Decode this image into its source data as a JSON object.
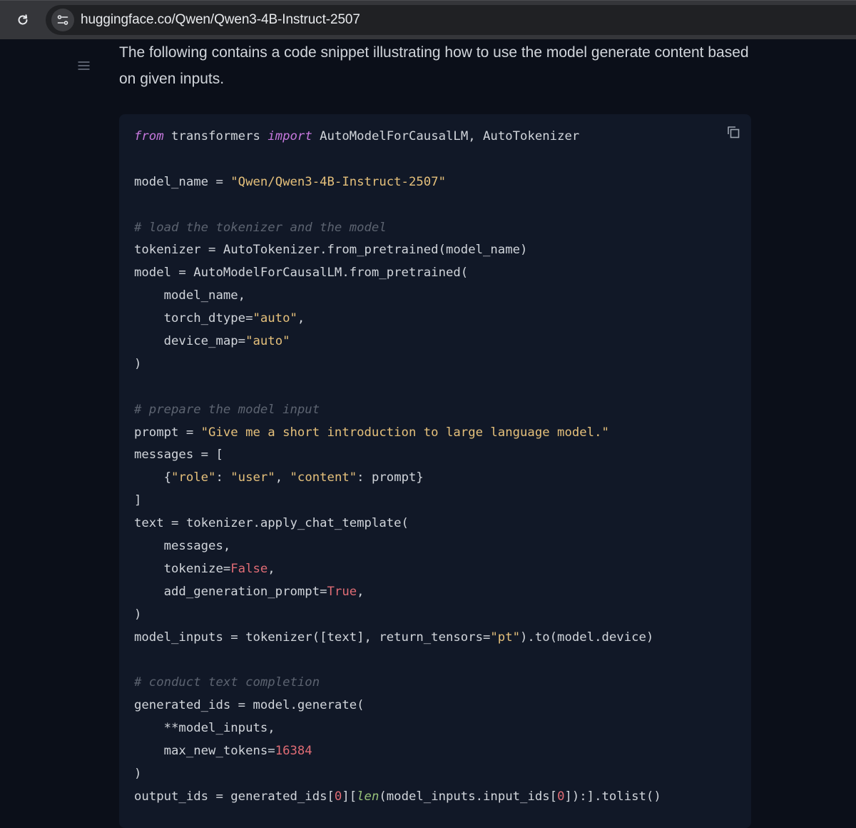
{
  "browser": {
    "url": "huggingface.co/Qwen/Qwen3-4B-Instruct-2507",
    "icons": {
      "reload": "reload-icon",
      "site_info": "site-info-icon"
    }
  },
  "page": {
    "intro_text": "The following contains a code snippet illustrating how to use the model generate content based on given inputs.",
    "icons": {
      "toc": "menu-icon",
      "copy": "copy-icon"
    }
  },
  "colors": {
    "keyword": "#c678dd",
    "string": "#e5c07b",
    "comment": "#5c6370",
    "boolean": "#e06c75",
    "number": "#e06c75",
    "builtin": "#98c379",
    "plain": "#d1d5db"
  },
  "code": {
    "language": "python",
    "lines": [
      [
        {
          "t": "from",
          "k": "keyword"
        },
        {
          "t": " transformers ",
          "k": "plain"
        },
        {
          "t": "import",
          "k": "keyword"
        },
        {
          "t": " AutoModelForCausalLM, AutoTokenizer",
          "k": "plain"
        }
      ],
      [],
      [
        {
          "t": "model_name = ",
          "k": "plain"
        },
        {
          "t": "\"Qwen/Qwen3-4B-Instruct-2507\"",
          "k": "string"
        }
      ],
      [],
      [
        {
          "t": "# load the tokenizer and the model",
          "k": "comment"
        }
      ],
      [
        {
          "t": "tokenizer = AutoTokenizer.from_pretrained(model_name)",
          "k": "plain"
        }
      ],
      [
        {
          "t": "model = AutoModelForCausalLM.from_pretrained(",
          "k": "plain"
        }
      ],
      [
        {
          "t": "    model_name,",
          "k": "plain"
        }
      ],
      [
        {
          "t": "    torch_dtype=",
          "k": "plain"
        },
        {
          "t": "\"auto\"",
          "k": "string"
        },
        {
          "t": ",",
          "k": "plain"
        }
      ],
      [
        {
          "t": "    device_map=",
          "k": "plain"
        },
        {
          "t": "\"auto\"",
          "k": "string"
        }
      ],
      [
        {
          "t": ")",
          "k": "plain"
        }
      ],
      [],
      [
        {
          "t": "# prepare the model input",
          "k": "comment"
        }
      ],
      [
        {
          "t": "prompt = ",
          "k": "plain"
        },
        {
          "t": "\"Give me a short introduction to large language model.\"",
          "k": "string"
        }
      ],
      [
        {
          "t": "messages = [",
          "k": "plain"
        }
      ],
      [
        {
          "t": "    {",
          "k": "plain"
        },
        {
          "t": "\"role\"",
          "k": "string"
        },
        {
          "t": ": ",
          "k": "plain"
        },
        {
          "t": "\"user\"",
          "k": "string"
        },
        {
          "t": ", ",
          "k": "plain"
        },
        {
          "t": "\"content\"",
          "k": "string"
        },
        {
          "t": ": prompt}",
          "k": "plain"
        }
      ],
      [
        {
          "t": "]",
          "k": "plain"
        }
      ],
      [
        {
          "t": "text = tokenizer.apply_chat_template(",
          "k": "plain"
        }
      ],
      [
        {
          "t": "    messages,",
          "k": "plain"
        }
      ],
      [
        {
          "t": "    tokenize=",
          "k": "plain"
        },
        {
          "t": "False",
          "k": "bool"
        },
        {
          "t": ",",
          "k": "plain"
        }
      ],
      [
        {
          "t": "    add_generation_prompt=",
          "k": "plain"
        },
        {
          "t": "True",
          "k": "bool"
        },
        {
          "t": ",",
          "k": "plain"
        }
      ],
      [
        {
          "t": ")",
          "k": "plain"
        }
      ],
      [
        {
          "t": "model_inputs = tokenizer([text], return_tensors=",
          "k": "plain"
        },
        {
          "t": "\"pt\"",
          "k": "string"
        },
        {
          "t": ").to(model.device)",
          "k": "plain"
        }
      ],
      [],
      [
        {
          "t": "# conduct text completion",
          "k": "comment"
        }
      ],
      [
        {
          "t": "generated_ids = model.generate(",
          "k": "plain"
        }
      ],
      [
        {
          "t": "    **model_inputs,",
          "k": "plain"
        }
      ],
      [
        {
          "t": "    max_new_tokens=",
          "k": "plain"
        },
        {
          "t": "16384",
          "k": "number"
        }
      ],
      [
        {
          "t": ")",
          "k": "plain"
        }
      ],
      [
        {
          "t": "output_ids = generated_ids[",
          "k": "plain"
        },
        {
          "t": "0",
          "k": "number"
        },
        {
          "t": "][",
          "k": "plain"
        },
        {
          "t": "len",
          "k": "builtin"
        },
        {
          "t": "(model_inputs.input_ids[",
          "k": "plain"
        },
        {
          "t": "0",
          "k": "number"
        },
        {
          "t": "]):].tolist()",
          "k": "plain"
        }
      ]
    ]
  }
}
